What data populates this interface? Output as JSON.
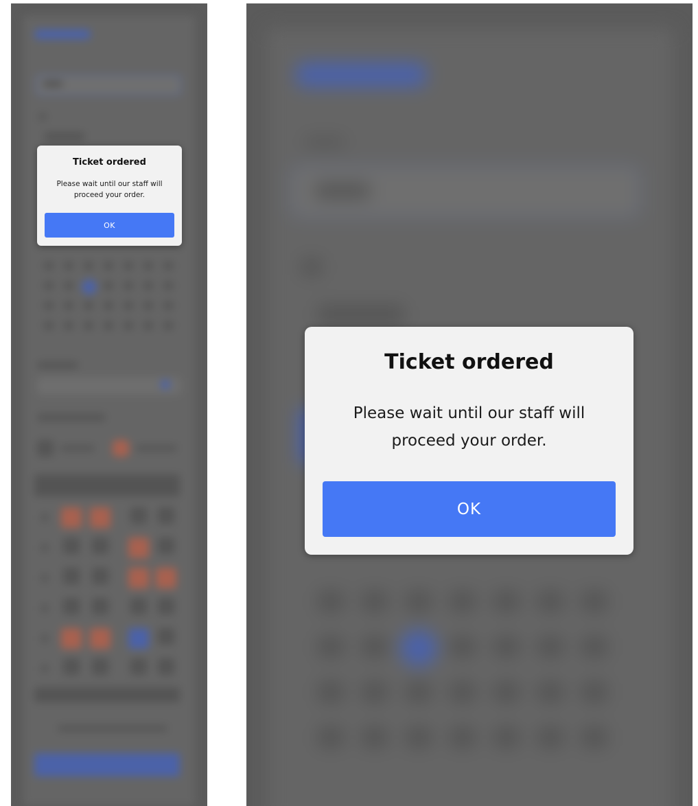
{
  "dialog": {
    "title": "Ticket ordered",
    "message": "Please wait until our staff will proceed your order.",
    "ok_label": "OK"
  },
  "colors": {
    "overlay": "#5b5b5b",
    "dialog_bg": "#f2f2f2",
    "ok_button": "#4578f5",
    "accent_blurred": "#4b62a8",
    "booked_seat": "#a8614f"
  }
}
